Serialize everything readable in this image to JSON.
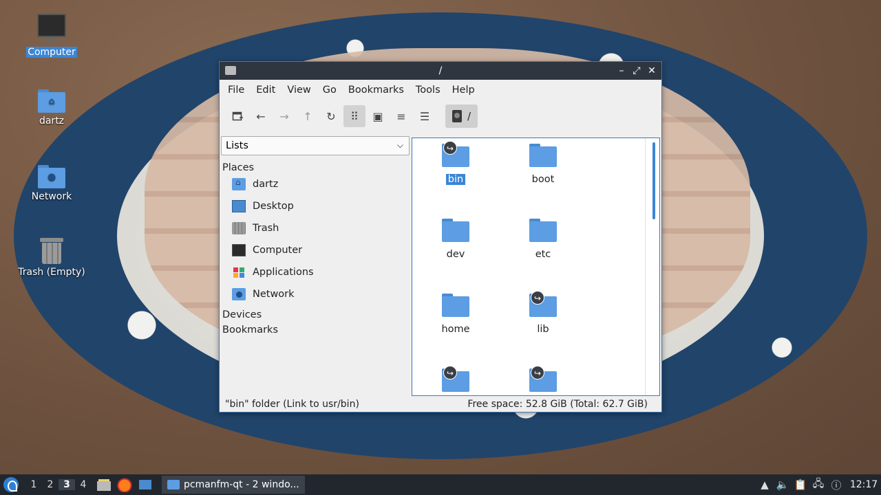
{
  "desktop": {
    "icons": [
      {
        "label": "Computer",
        "icon": "computer-icon"
      },
      {
        "label": "dartz",
        "icon": "home-folder-icon"
      },
      {
        "label": "Network",
        "icon": "network-folder-icon"
      },
      {
        "label": "Trash (Empty)",
        "icon": "trash-icon"
      }
    ]
  },
  "window": {
    "title": "/",
    "menu": [
      "File",
      "Edit",
      "View",
      "Go",
      "Bookmarks",
      "Tools",
      "Help"
    ],
    "toolbar": {
      "new_tab": "new-tab-icon",
      "back": "←",
      "forward": "→",
      "up": "↑",
      "reload": "↻",
      "view_icons": "⠿",
      "view_thumbs": "▣",
      "view_compact": "≡",
      "view_details": "☰",
      "path": "/"
    },
    "sidebar": {
      "mode": "Lists",
      "places_header": "Places",
      "places": [
        {
          "label": "dartz",
          "icon": "home-folder-icon"
        },
        {
          "label": "Desktop",
          "icon": "desktop-icon"
        },
        {
          "label": "Trash",
          "icon": "trash-icon"
        },
        {
          "label": "Computer",
          "icon": "computer-icon"
        },
        {
          "label": "Applications",
          "icon": "applications-icon"
        },
        {
          "label": "Network",
          "icon": "network-icon"
        }
      ],
      "devices_header": "Devices",
      "bookmarks_header": "Bookmarks"
    },
    "files": [
      {
        "name": "bin",
        "link": true,
        "selected": true
      },
      {
        "name": "boot",
        "link": false
      },
      {
        "name": "dev",
        "link": false
      },
      {
        "name": "etc",
        "link": false
      },
      {
        "name": "home",
        "link": false
      },
      {
        "name": "lib",
        "link": true
      },
      {
        "name": "",
        "link": true
      },
      {
        "name": "",
        "link": true
      }
    ],
    "status": {
      "left": "\"bin\" folder (Link to usr/bin)",
      "right": "Free space: 52.8 GiB (Total: 62.7 GiB)"
    }
  },
  "taskbar": {
    "workspaces": [
      "1",
      "2",
      "3",
      "4"
    ],
    "current_workspace": "3",
    "task_label": "pcmanfm-qt - 2 windo...",
    "clock": "12:17"
  },
  "colors": {
    "accent": "#3a86d6",
    "titlebar": "#2f3640",
    "taskbar": "#22272e",
    "folder": "#5c9de3"
  }
}
